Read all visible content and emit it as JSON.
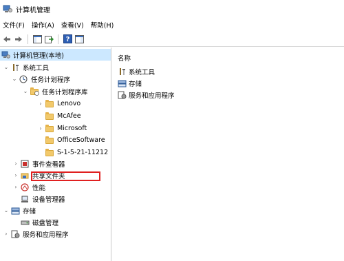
{
  "window": {
    "title": "计算机管理"
  },
  "menu": [
    "文件(F)",
    "操作(A)",
    "查看(V)",
    "帮助(H)"
  ],
  "toolbar": {
    "buttons": [
      "back-icon",
      "forward-icon",
      "console-tree-icon",
      "export-icon",
      "help-icon",
      "show-pane-icon"
    ]
  },
  "tree": {
    "root": "计算机管理(本地)",
    "system_tools": "系统工具",
    "task_scheduler": "任务计划程序",
    "task_library": "任务计划程序库",
    "lenovo": "Lenovo",
    "mcafee": "McAfee",
    "microsoft": "Microsoft",
    "office": "OfficeSoftware",
    "sid": "S-1-5-21-11212",
    "event_viewer": "事件查看器",
    "shared_folders": "共享文件夹",
    "performance": "性能",
    "device_manager": "设备管理器",
    "storage": "存储",
    "disk_mgmt": "磁盘管理",
    "services_apps": "服务和应用程序"
  },
  "list": {
    "header": "名称",
    "items": [
      "系统工具",
      "存储",
      "服务和应用程序"
    ]
  },
  "colors": {
    "selection": "#cce8ff",
    "highlight_box": "#e02020",
    "folder": "#f2c96b"
  }
}
